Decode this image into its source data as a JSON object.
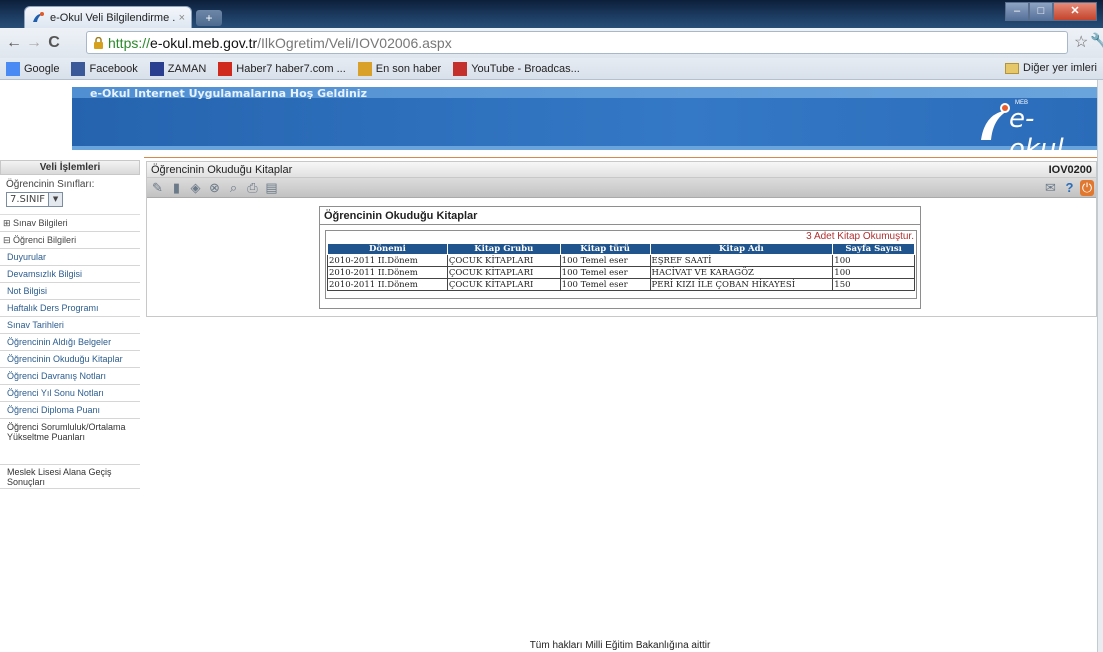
{
  "browser": {
    "tab_title": "e-Okul Veli Bilgilendirme ...",
    "tab_close": "×",
    "new_tab": "+",
    "url_scheme": "https://",
    "url_host": "e-okul.meb.gov.tr",
    "url_path": "/IlkOgretim/Veli/IOV02006.aspx",
    "bookmarks": [
      {
        "label": "Google",
        "icon": "google-icon",
        "color": "#4a8af4"
      },
      {
        "label": "Facebook",
        "icon": "facebook-icon",
        "color": "#3b5998"
      },
      {
        "label": "ZAMAN",
        "icon": "zaman-icon",
        "color": "#2a3f8f"
      },
      {
        "label": "Haber7 haber7.com ...",
        "icon": "haber7-icon",
        "color": "#d02a1e"
      },
      {
        "label": "En son haber",
        "icon": "news-icon",
        "color": "#d9a12a"
      },
      {
        "label": "YouTube - Broadcas...",
        "icon": "youtube-icon",
        "color": "#c4302b"
      }
    ],
    "other_bookmarks": "Diğer yer imleri"
  },
  "banner": {
    "welcome": "e-Okul Internet Uygulamalarına Hoş Geldiniz",
    "logo_text": "e-okul",
    "logo_small": "MEB"
  },
  "sidebar": {
    "header": "Veli İşlemleri",
    "class_label": "Öğrencinin Sınıfları:",
    "class_value": "7.SINIF",
    "items": [
      {
        "label": "⊞ Sınav Bilgileri",
        "type": "grp"
      },
      {
        "label": "⊟ Öğrenci Bilgileri",
        "type": "grp"
      },
      {
        "label": "Duyurular",
        "type": "lnk"
      },
      {
        "label": "Devamsızlık Bilgisi",
        "type": "lnk"
      },
      {
        "label": "Not Bilgisi",
        "type": "lnk"
      },
      {
        "label": "Haftalık Ders Programı",
        "type": "lnk"
      },
      {
        "label": "Sınav Tarihleri",
        "type": "lnk"
      },
      {
        "label": "Öğrencinin Aldığı Belgeler",
        "type": "lnk"
      },
      {
        "label": "Öğrencinin Okuduğu Kitaplar",
        "type": "lnk"
      },
      {
        "label": "Öğrenci Davranış Notları",
        "type": "lnk"
      },
      {
        "label": "Öğrenci Yıl Sonu Notları",
        "type": "lnk"
      },
      {
        "label": "Öğrenci Diploma Puanı",
        "type": "lnk"
      },
      {
        "label": "Öğrenci Sorumluluk/Ortalama Yükseltme Puanları",
        "type": "tall"
      },
      {
        "label": "Meslek Lisesi Alana Geçiş Sonuçları",
        "type": "tall2"
      }
    ]
  },
  "content": {
    "title": "Öğrencinin Okuduğu Kitaplar",
    "page_code": "IOV0200",
    "panel_title": "Öğrencinin Okuduğu Kitaplar",
    "count_text": "3 Adet Kitap Okumuştur.",
    "columns": [
      "Dönemi",
      "Kitap Grubu",
      "Kitap türü",
      "Kitap Adı",
      "Sayfa Sayısı"
    ],
    "rows": [
      [
        "2010-2011 II.Dönem",
        "ÇOCUK KİTAPLARI",
        "100 Temel eser",
        "EŞREF SAATİ",
        "100"
      ],
      [
        "2010-2011 II.Dönem",
        "ÇOCUK KİTAPLARI",
        "100 Temel eser",
        "HACİVAT VE KARAGÖZ",
        "100"
      ],
      [
        "2010-2011 II.Dönem",
        "ÇOCUK KİTAPLARI",
        "100 Temel eser",
        "PERİ KIZI İLE ÇOBAN HİKAYESİ",
        "150"
      ]
    ]
  },
  "footer": "Tüm hakları Milli Eğitim Bakanlığına aittir"
}
